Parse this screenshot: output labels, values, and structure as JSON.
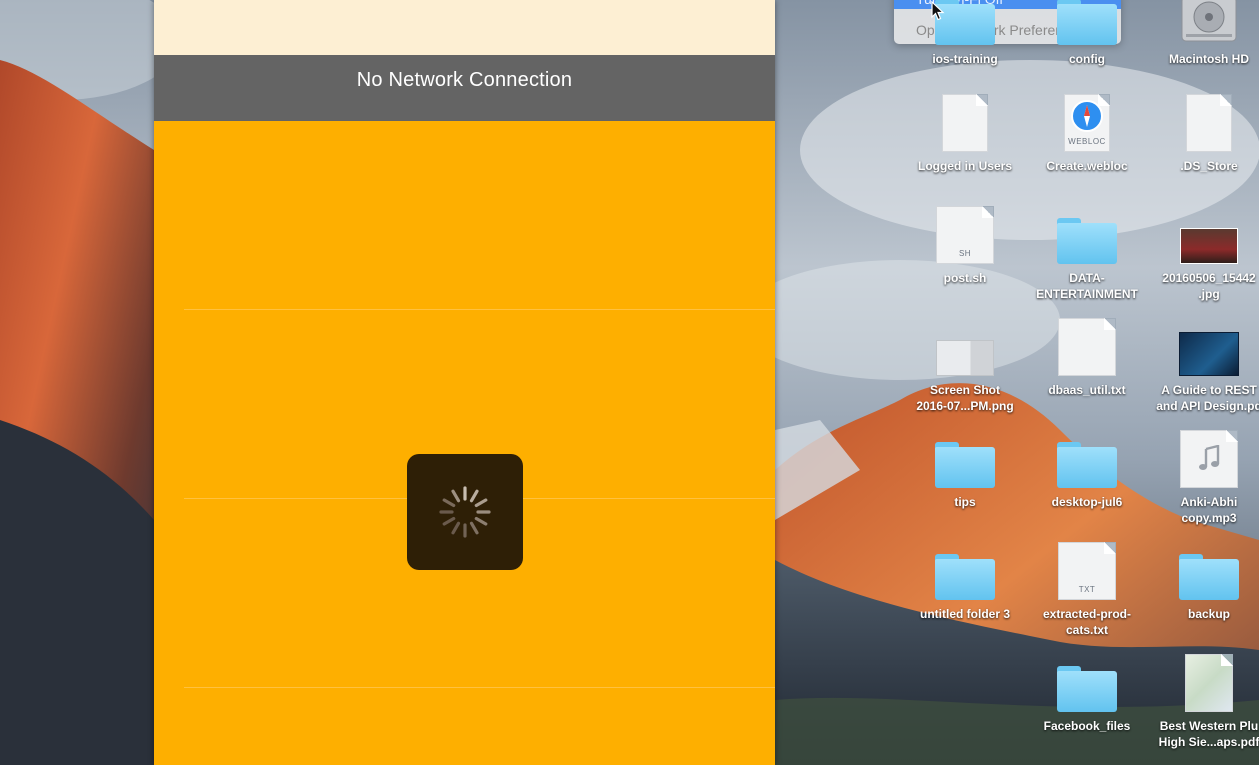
{
  "simulator": {
    "banner_text": "No Network Connection"
  },
  "network_menu": {
    "wifi_item": "Turn Wi-Fi Off",
    "prefs_item": "Open Network Preferences..."
  },
  "desktop": {
    "icons": [
      {
        "label": "ios-training",
        "kind": "folder"
      },
      {
        "label": "config",
        "kind": "folder"
      },
      {
        "label": "Macintosh HD",
        "kind": "drive"
      },
      {
        "label": "Logged in Users",
        "kind": "doc"
      },
      {
        "label": "Create.webloc",
        "kind": "webloc",
        "badge": "WEBLOC"
      },
      {
        "label": ".DS_Store",
        "kind": "doc"
      },
      {
        "label": "post.sh",
        "kind": "script",
        "badge": "SH"
      },
      {
        "label": "DATA-\nENTERTAINMENT",
        "kind": "folder"
      },
      {
        "label": "20160506_15442\n.jpg",
        "kind": "photo"
      },
      {
        "label": "Screen Shot\n2016-07...PM.png",
        "kind": "screenshot"
      },
      {
        "label": "dbaas_util.txt",
        "kind": "text"
      },
      {
        "label": "A Guide to REST\nand API Design.pd",
        "kind": "pdf"
      },
      {
        "label": "tips",
        "kind": "folder"
      },
      {
        "label": "desktop-jul6",
        "kind": "folder"
      },
      {
        "label": "Anki-Abhi\ncopy.mp3",
        "kind": "audio"
      },
      {
        "label": "untitled folder 3",
        "kind": "folder"
      },
      {
        "label": "extracted-prod-\ncats.txt",
        "kind": "text",
        "badge": "TXT"
      },
      {
        "label": "backup",
        "kind": "folder"
      },
      {
        "label": "Facebook_files",
        "kind": "folder"
      },
      {
        "label": "Best Western Plu\nHigh Sie...aps.pdf",
        "kind": "map"
      }
    ]
  },
  "colors": {
    "simulator_bg": "#feaf00",
    "banner_bg": "#646464",
    "top_strip": "#fdefd3",
    "spinner_bg": "#2e1f06",
    "menu_highlight": "#4a8ff0"
  }
}
